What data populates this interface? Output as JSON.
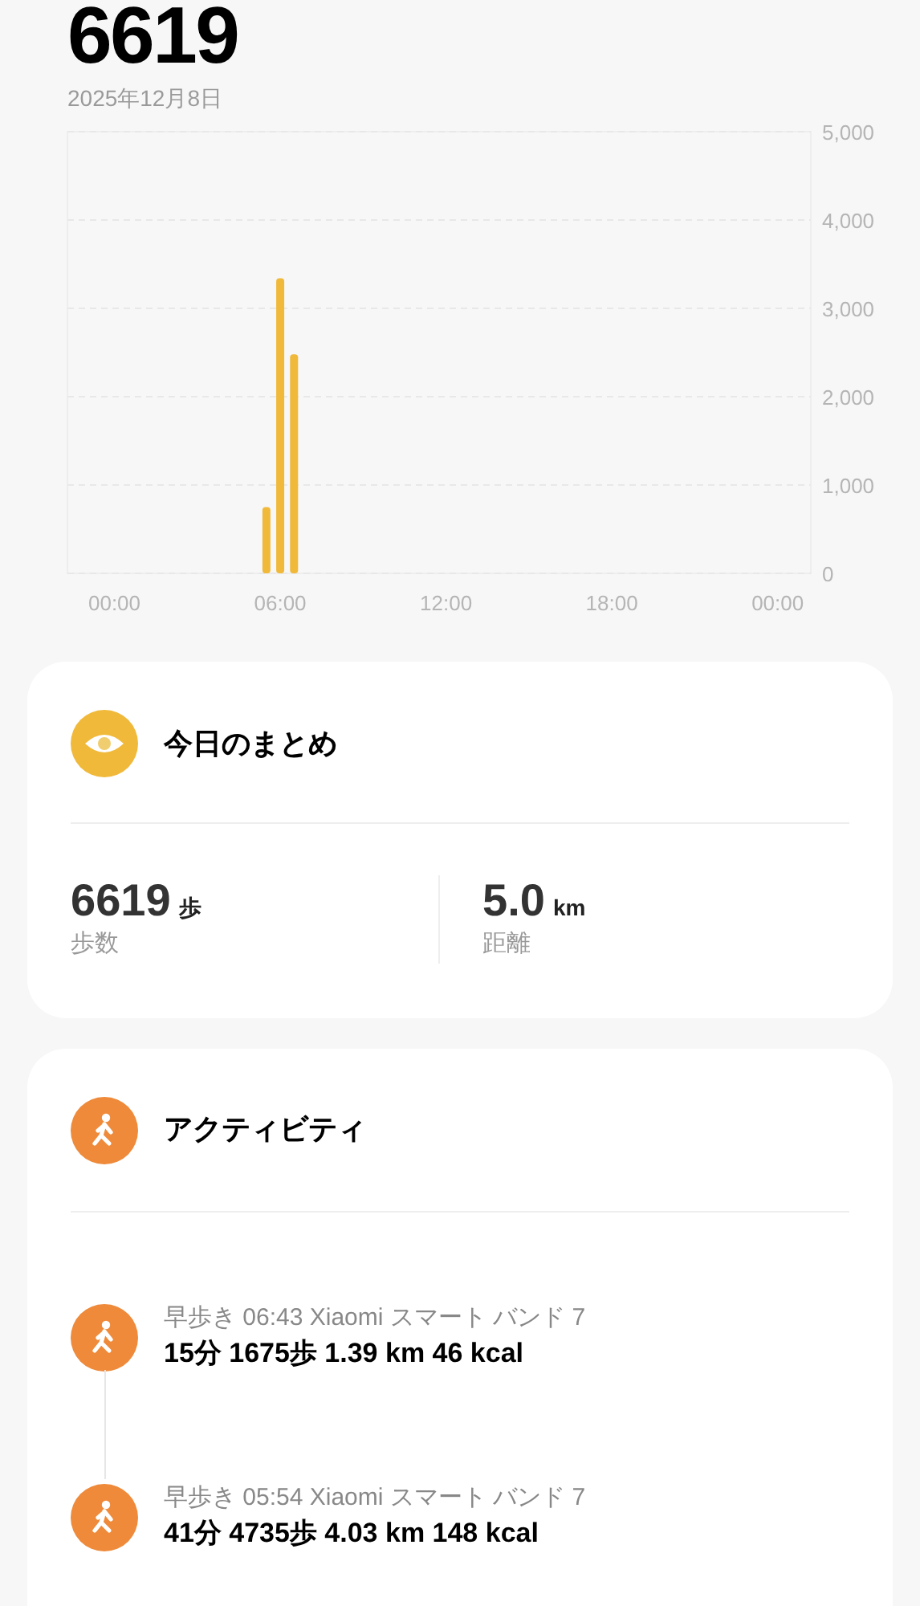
{
  "total_steps": "6619",
  "date": "2025年12月8日",
  "chart": {
    "chart_data": {
      "type": "bar",
      "x": [
        5.5,
        6,
        6.5
      ],
      "series": [
        {
          "color": "#f0b93a",
          "values": [
            750,
            3340,
            2480
          ]
        }
      ],
      "xlim": [
        -1.7,
        25.2
      ],
      "ylim": [
        0,
        5000
      ],
      "grid": true,
      "xticks": [
        {
          "value": 0,
          "label": "00:00"
        },
        {
          "value": 6,
          "label": "06:00"
        },
        {
          "value": 12,
          "label": "12:00"
        },
        {
          "value": 18,
          "label": "18:00"
        },
        {
          "value": 24,
          "label": "00:00"
        }
      ],
      "yticks": [
        {
          "value": 0,
          "label": "0"
        },
        {
          "value": 1000,
          "label": "1,000"
        },
        {
          "value": 2000,
          "label": "2,000"
        },
        {
          "value": 3000,
          "label": "3,000"
        },
        {
          "value": 4000,
          "label": "4,000"
        },
        {
          "value": 5000,
          "label": "5,000"
        }
      ]
    }
  },
  "summary": {
    "title": "今日のまとめ",
    "stats": [
      {
        "value": "6619",
        "unit": "歩",
        "label": "歩数"
      },
      {
        "value": "5.0",
        "unit": "km",
        "label": "距離"
      }
    ]
  },
  "activity": {
    "title": "アクティビティ",
    "items": [
      {
        "meta": "早歩き 06:43 Xiaomi スマート バンド 7",
        "detail": "15分 1675歩 1.39 km 46 kcal"
      },
      {
        "meta": "早歩き 05:54 Xiaomi スマート バンド 7",
        "detail": "41分 4735歩 4.03 km 148 kcal"
      }
    ]
  }
}
